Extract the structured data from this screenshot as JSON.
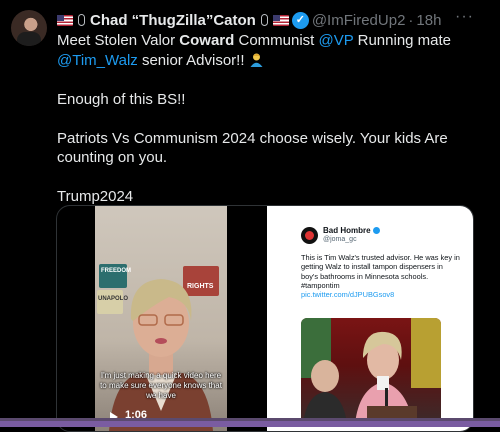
{
  "tweet": {
    "display_name": "Chad “ThugZilla”Caton",
    "handle": "@ImFiredUp2",
    "separator": "·",
    "time": "18h",
    "more_label": "···",
    "verified_mark": "✓",
    "line1_a": "Meet Stolen Valor ",
    "line1_b": "Coward",
    "line1_c": " Communist ",
    "line1_mention": "@VP",
    "line1_d": "  Running mate",
    "line2_mention": "@Tim_Walz",
    "line2_text": " senior Advisor!! ",
    "para2": "Enough of this BS!!",
    "para3": "Patriots Vs Communism 2024 choose wisely.  Your kids Are counting on you.",
    "para4": "Trump2024"
  },
  "video": {
    "caption": "I'm just making a quick video here to make sure everyone knows that we have",
    "timer": "1:06",
    "poster1": "FREEDOM",
    "poster2": "RIGHTS",
    "poster3": "UNAPOLO"
  },
  "screenshot": {
    "name": "Bad Hombre",
    "handle": "@joma_gc",
    "text": "This is Tim Walz's trusted advisor. He was key in getting Walz to install tampon dispensers in boy's bathrooms in Minnesota schools. #tampontim",
    "link": "pic.twitter.com/dJPUBGsov8"
  },
  "colors": {
    "accent": "#1d9bf0",
    "bg": "#000000",
    "text": "#e7e9ea",
    "muted": "#71767b"
  },
  "icons": [
    "us-flag-icon",
    "microphone-icon",
    "verified-badge-icon",
    "more-options-icon",
    "play-icon",
    "man-emoji-icon"
  ]
}
